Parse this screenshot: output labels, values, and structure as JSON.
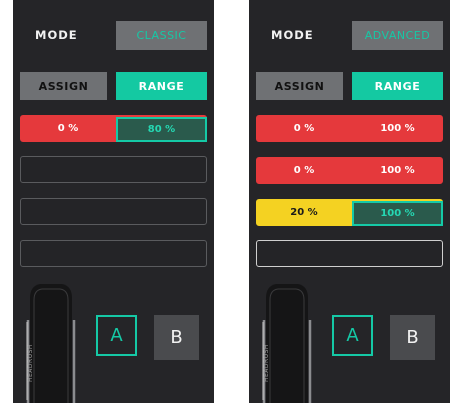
{
  "left_screen": {
    "mode_label": "MODE",
    "mode_value": "CLASSIC",
    "tab_assign": "ASSIGN",
    "tab_range": "RANGE",
    "ranges": [
      {
        "low": "0 %",
        "high": "80 %"
      }
    ],
    "footswitch_a": "A",
    "footswitch_b": "B",
    "pedal_label": "HEADRUSH"
  },
  "right_screen": {
    "mode_label": "MODE",
    "mode_value": "ADVANCED",
    "tab_assign": "ASSIGN",
    "tab_range": "RANGE",
    "ranges": [
      {
        "low": "0 %",
        "high": "100 %"
      },
      {
        "low": "0 %",
        "high": "100 %"
      },
      {
        "low": "20 %",
        "high": "100 %"
      }
    ],
    "footswitch_a": "A",
    "footswitch_b": "B",
    "pedal_label": "HEADRUSH"
  },
  "colors": {
    "accent": "#15c9a6",
    "range_red": "#e5393c",
    "range_yellow": "#f4d222",
    "panel": "#252528",
    "button_gray": "#6f7174"
  }
}
